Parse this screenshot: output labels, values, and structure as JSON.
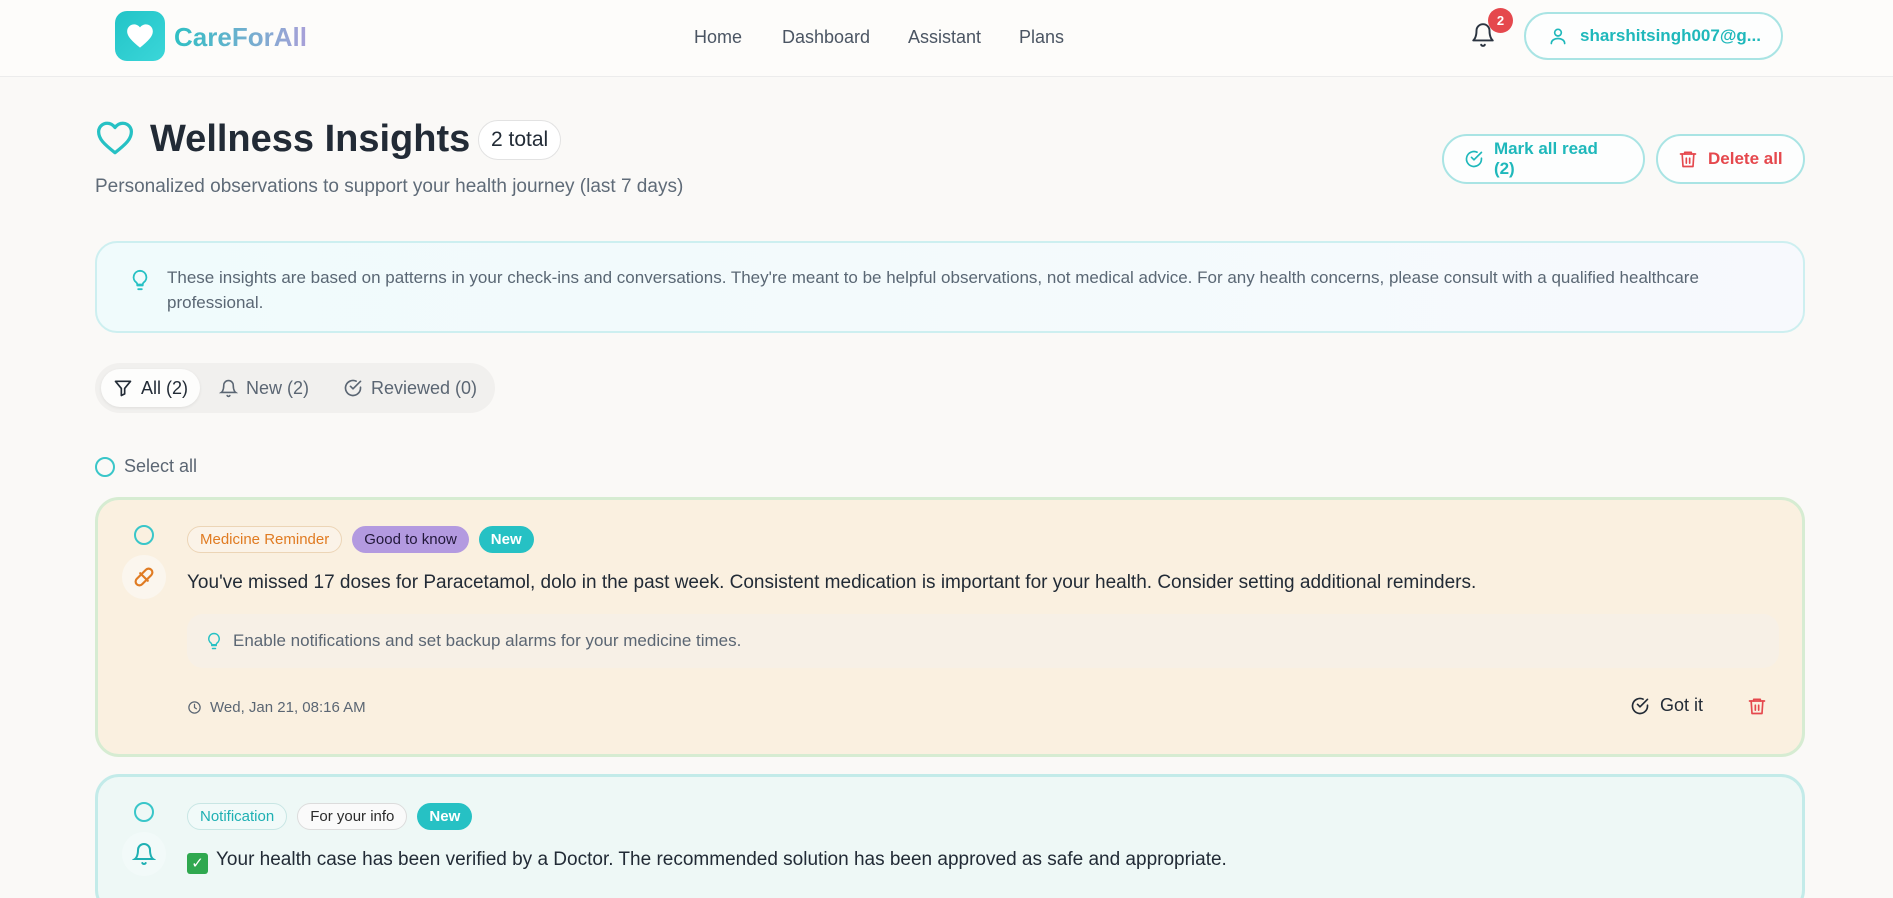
{
  "header": {
    "brand": "CareForAll",
    "nav": [
      "Home",
      "Dashboard",
      "Assistant",
      "Plans"
    ],
    "notification_count": "2",
    "user_email": "sharshitsingh007@g..."
  },
  "page": {
    "title": "Wellness Insights",
    "total": "2 total",
    "subtitle": "Personalized observations to support your health journey (last 7 days)",
    "mark_all_read": "Mark all read (2)",
    "delete_all": "Delete all"
  },
  "banner": {
    "text": "These insights are based on patterns in your check-ins and conversations. They're meant to be helpful observations, not medical advice. For any health concerns, please consult with a qualified healthcare professional."
  },
  "filters": [
    {
      "label": "All (2)",
      "active": true
    },
    {
      "label": "New (2)",
      "active": false
    },
    {
      "label": "Reviewed (0)",
      "active": false
    }
  ],
  "select_all": "Select all",
  "insights": [
    {
      "category": "Medicine Reminder",
      "severity": "Good to know",
      "status": "New",
      "message": "You've missed 17 doses for Paracetamol, dolo in the past week. Consistent medication is important for your health. Consider setting additional reminders.",
      "tip": "Enable notifications and set backup alarms for your medicine times.",
      "timestamp": "Wed, Jan 21, 08:16 AM",
      "action": "Got it"
    },
    {
      "category": "Notification",
      "severity": "For your info",
      "status": "New",
      "message": "Your health case has been verified by a Doctor. The recommended solution has been approved as safe and appropriate."
    }
  ],
  "colors": {
    "accent": "#26c1c4",
    "danger": "#e5484d",
    "medicine": "#e07b22",
    "good_to_know": "#b39ae0"
  }
}
